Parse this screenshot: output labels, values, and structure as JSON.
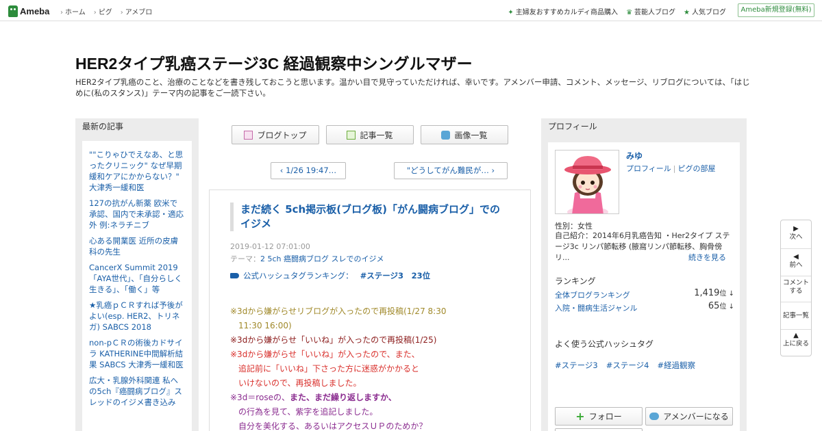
{
  "topbar": {
    "logo": "Ameba",
    "nav": [
      "ホーム",
      "ピグ",
      "アメブロ"
    ],
    "links": [
      {
        "icon": "sparkle-icon",
        "label": "主婦友おすすめカルディ商品購入"
      },
      {
        "icon": "crown-icon",
        "label": "芸能人ブログ"
      },
      {
        "icon": "star-icon",
        "label": "人気ブログ"
      }
    ],
    "register": "Ameba新規登録(無料)"
  },
  "blog": {
    "title": "HER2タイプ乳癌ステージ3C 経過観察中シングルマザー",
    "description": "HER2タイプ乳癌のこと、治療のことなどを書き残しておこうと思います。温かい目で見守っていただければ、幸いです。アメンバー申請、コメント、メッセージ、リブログについては、「はじめに(私のスタンス)」テーマ内の記事をご一読下さい。"
  },
  "recent": {
    "heading": "最新の記事",
    "items": [
      "\"\"こりゃひでえなあ、と思ったクリニック\" なぜ早期緩和ケアにかからない？\" 大津秀一緩和医",
      "127の抗がん新薬 欧米で承認、国内で未承認・適応外 例:ネラチニブ",
      "心ある開業医 近所の皮膚科の先生",
      "CancerX Summit 2019「AYA世代」、「自分らしく生きる」、「働く」等",
      "★乳癌ｐＣＲすれば予後がよい(esp. HER2、トリネガ) SABCS 2018",
      "non-pＣＲの術後カドサイラ KATHERINE中間解析結果 SABCS 大津秀一緩和医",
      "広大・乳腺外科関連 私への5ch『癌闘病ブログ』スレッドのイジメ書き込み"
    ]
  },
  "tabs": {
    "top": "ブログトップ",
    "list": "記事一覧",
    "images": "画像一覧"
  },
  "pager": {
    "prev": "1/26 19:47…",
    "next": "\"どうしてがん難民が…"
  },
  "article": {
    "title": "まだ続く 5ch掲示板(ブログ板)「がん闘病ブログ」でのイジメ",
    "date": "2019-01-12 07:01:00",
    "theme_label": "テーマ：",
    "theme": "2 5ch 癌闘病ブログ スレでのイジメ",
    "hashtag_label": "公式ハッシュタグランキング：",
    "hashtag": "#ステージ3　23位",
    "lines": [
      {
        "color": "#a0892a",
        "text": "※3dから嫌がらせリブログが入ったので再投稿(1/27 8:30"
      },
      {
        "color": "#a0892a",
        "text": "　11:30  16:00)"
      },
      {
        "color": "#8b1a1a",
        "text": "※3dから嫌がらせ「いいね」が入ったので再投稿(1/25)"
      },
      {
        "color": "#d9302c",
        "text": "※3dから嫌がらせ「いいね」が入ったので、また、"
      },
      {
        "color": "#d9302c",
        "text": "　追記前に「いいね」下さった方に迷惑がかかると"
      },
      {
        "color": "#d9302c",
        "text": "　いけないので、再投稿しました。"
      },
      {
        "color": "#8a2b8f",
        "text": "※3d＝roseの、",
        "bold": "また、まだ繰り返しますか、"
      },
      {
        "color": "#8a2b8f",
        "text": "　の行為を見て、紫字を追記しました。"
      },
      {
        "color": "#8a2b8f",
        "text": "　自分を美化する、あるいはアクセスＵＰのためか？"
      }
    ]
  },
  "profile": {
    "heading": "プロフィール",
    "name": "みゆ",
    "link_profile": "プロフィール",
    "link_pig": "ピグの部屋",
    "gender": "性別：女性",
    "intro": "自己紹介：2014年6月乳癌告知 ・Her2タイプ ステージ3c リンパ節転移 (腋窩リンパ節転移、胸骨傍リ...",
    "more": "続きを見る",
    "ranking_heading": "ランキング",
    "rankings": [
      {
        "label": "全体ブログランキング",
        "value": "1,419",
        "unit": "位 ↓"
      },
      {
        "label": "入院・闘病生活ジャンル",
        "value": "65",
        "unit": "位 ↓"
      }
    ],
    "hashtag_heading": "よく使う公式ハッシュタグ",
    "hashtags": [
      "#ステージ3",
      "#ステージ4",
      "#経過観察"
    ],
    "follow": "フォロー",
    "amember": "アメンバーになる"
  },
  "sidenav": {
    "next": "次へ",
    "prev": "前へ",
    "comment": "コメントする",
    "list": "記事一覧",
    "top": "上に戻る"
  },
  "colors": {
    "brand": "#2d8c3c",
    "link": "#1a5fa8"
  }
}
